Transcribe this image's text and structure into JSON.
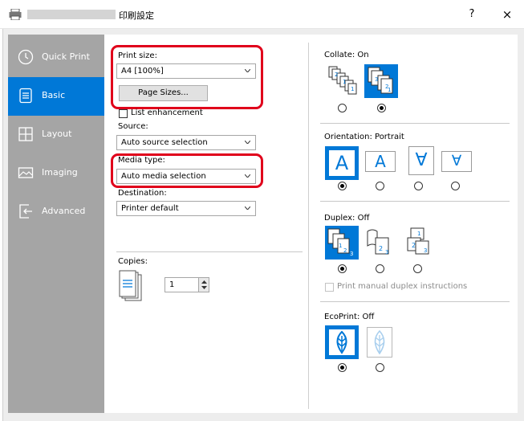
{
  "window": {
    "title": "印刷設定",
    "help_label": "?",
    "close_label": "×"
  },
  "nav": [
    {
      "label": "Quick Print",
      "icon": "clock-icon"
    },
    {
      "label": "Basic",
      "icon": "document-icon"
    },
    {
      "label": "Layout",
      "icon": "layout-grid-icon"
    },
    {
      "label": "Imaging",
      "icon": "image-icon"
    },
    {
      "label": "Advanced",
      "icon": "advanced-icon"
    }
  ],
  "basic": {
    "print_size": {
      "label": "Print size:",
      "value": "A4  [100%]"
    },
    "page_sizes_button": "Page Sizes...",
    "list_enhancement": {
      "label": "List enhancement",
      "checked": false
    },
    "source": {
      "label": "Source:",
      "value": "Auto source selection"
    },
    "media_type": {
      "label": "Media type:",
      "value": "Auto media selection"
    },
    "destination": {
      "label": "Destination:",
      "value": "Printer default"
    },
    "copies": {
      "label": "Copies:",
      "value": "1"
    },
    "collate": {
      "label": "Collate:",
      "state": "On",
      "selected_index": 1
    },
    "orientation": {
      "label": "Orientation:",
      "state": "Portrait",
      "glyphs": [
        "A",
        "A",
        "∀",
        "∀"
      ],
      "selected_index": 0
    },
    "duplex": {
      "label": "Duplex:",
      "state": "Off",
      "selected_index": 0
    },
    "manual_duplex": {
      "label": "Print manual duplex instructions",
      "enabled": false
    },
    "ecoprint": {
      "label": "EcoPrint:",
      "state": "Off",
      "selected_index": 0
    }
  },
  "colors": {
    "accent": "#0078d7",
    "highlight": "#e0001b",
    "sidebar": "#a5a5a5"
  }
}
